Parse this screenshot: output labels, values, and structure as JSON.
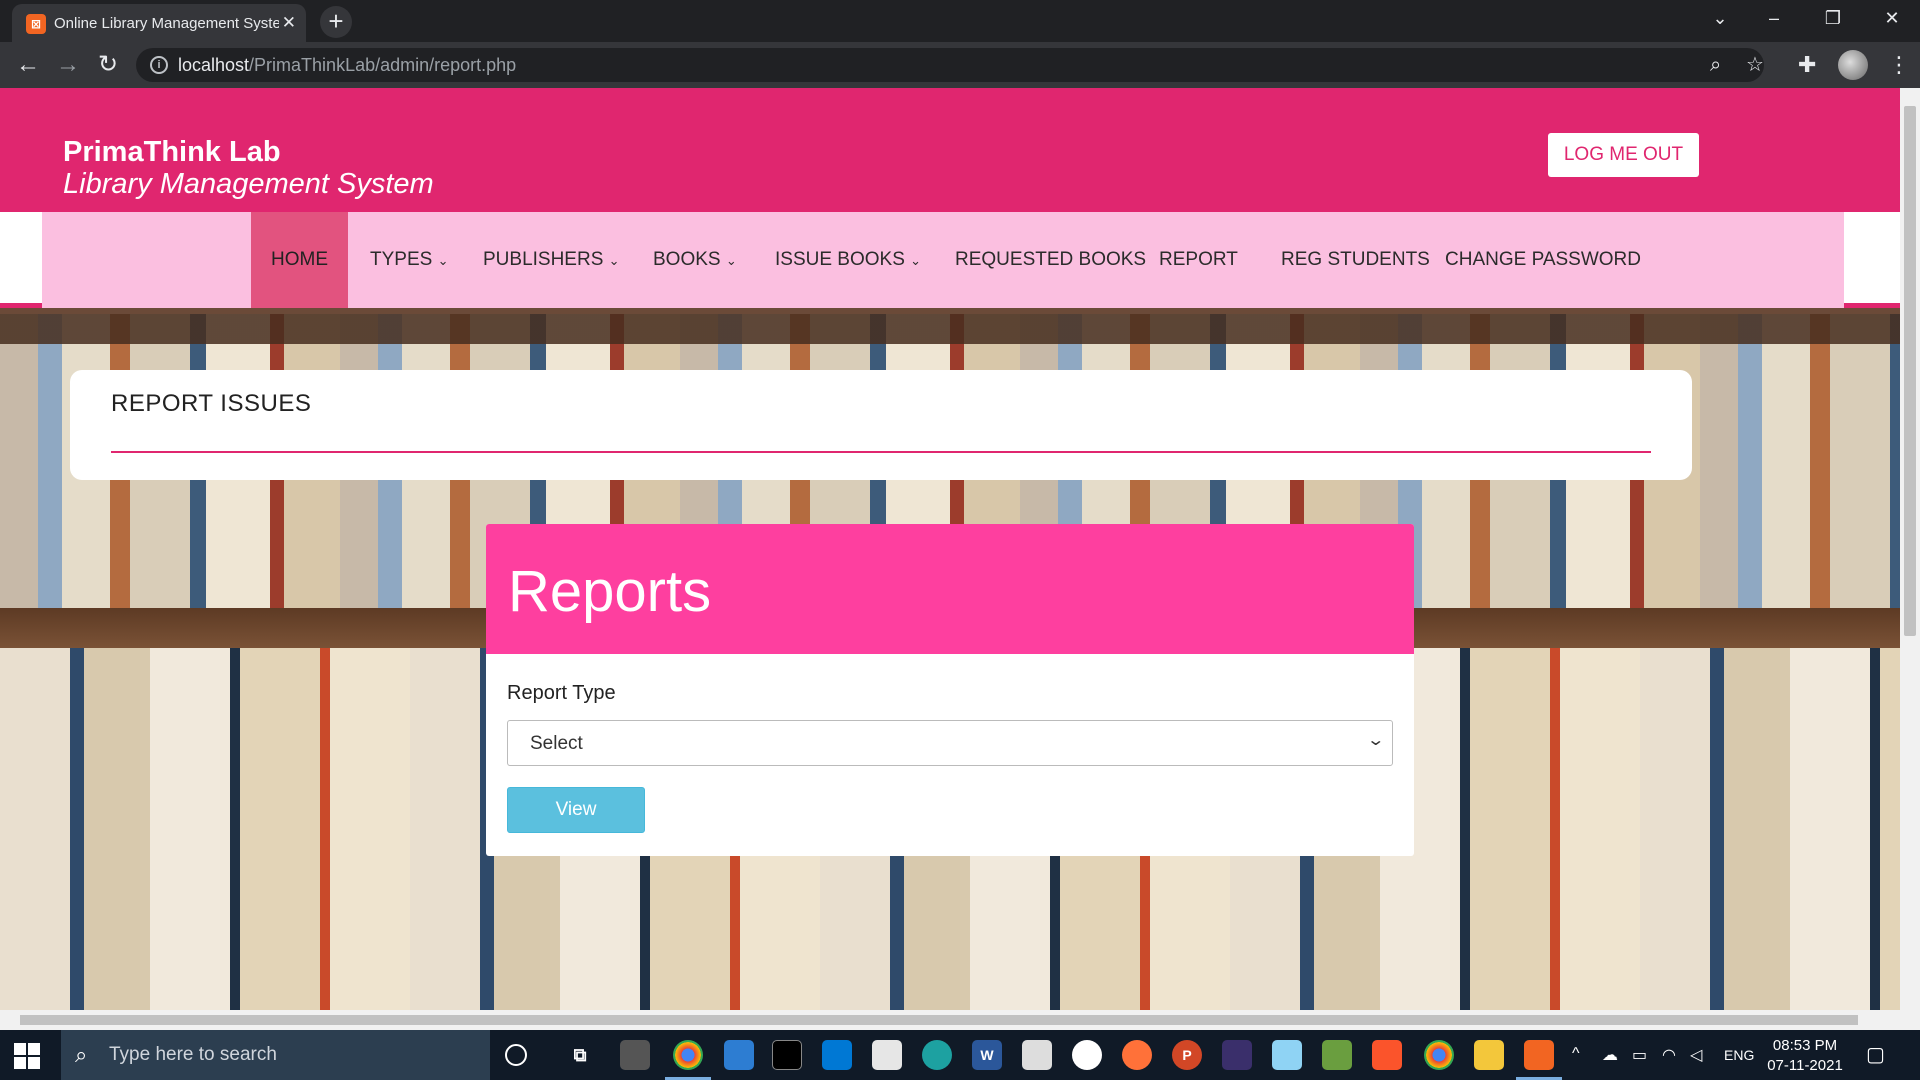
{
  "browser": {
    "tab_title": "Online Library Management System",
    "tab_favicon": "xampp-icon",
    "close_glyph": "✕",
    "new_tab_glyph": "+",
    "url_host": "localhost",
    "url_path": "/PrimaThinkLab/admin/report.php"
  },
  "header": {
    "brand_name": "PrimaThink Lab",
    "brand_tagline": "Library Management System",
    "logout_label": "LOG ME OUT"
  },
  "nav": {
    "items": [
      {
        "label": "HOME",
        "dropdown": false,
        "active": true
      },
      {
        "label": "TYPES",
        "dropdown": true
      },
      {
        "label": "PUBLISHERS",
        "dropdown": true
      },
      {
        "label": "BOOKS",
        "dropdown": true
      },
      {
        "label": "ISSUE BOOKS",
        "dropdown": true
      },
      {
        "label": "REQUESTED BOOKS",
        "dropdown": false
      },
      {
        "label": "REPORT",
        "dropdown": false
      },
      {
        "label": "REG STUDENTS",
        "dropdown": false
      },
      {
        "label": "CHANGE PASSWORD",
        "dropdown": false
      }
    ]
  },
  "page": {
    "section_title": "REPORT ISSUES"
  },
  "reports": {
    "title": "Reports",
    "field_label": "Report Type",
    "select_value": "Select",
    "view_button": "View"
  },
  "taskbar": {
    "search_placeholder": "Type here to search",
    "language": "ENG",
    "time": "08:53 PM",
    "date": "07-11-2021"
  },
  "colors": {
    "brand_pink": "#e0266f",
    "nav_bg": "#fbbfe0",
    "nav_active": "#e2537f",
    "reports_head": "#fe3f9f",
    "view_button": "#5bc0de"
  }
}
